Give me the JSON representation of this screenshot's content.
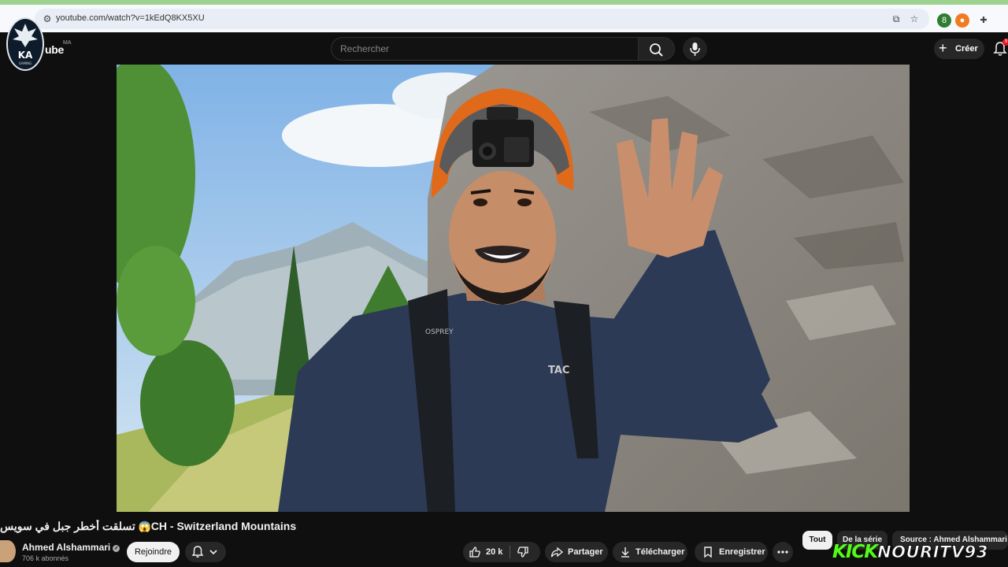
{
  "browser": {
    "url": "youtube.com/watch?v=1kEdQ8KX5XU",
    "extension_badge": "8"
  },
  "header": {
    "brand": "ube",
    "region": "MA",
    "logo_letters": "KA",
    "logo_subtext": "GAMING",
    "search_placeholder": "Rechercher",
    "create_label": "Créer",
    "notification_count": "9"
  },
  "video": {
    "title_arabic": "تسلقت أخطر جبل في سويس",
    "title_emoji": "😱",
    "title_suffix": "CH - Switzerland Mountains",
    "overlay_text_helmet": "OSPREY",
    "overlay_text_shirt": "TAC"
  },
  "channel": {
    "name": "Ahmed Alshammari",
    "subscribers": "706 k abonnés",
    "join_label": "Rejoindre"
  },
  "actions": {
    "likes": "20 k",
    "share_label": "Partager",
    "download_label": "Télécharger",
    "save_label": "Enregistrer"
  },
  "chips": {
    "all": "Tout",
    "series": "De la série",
    "source": "Source : Ahmed Alshammari"
  },
  "streamer_overlay": {
    "kick": "KICK",
    "handle": "NOURITV93"
  },
  "colors": {
    "background": "#0f0f0f",
    "kick_green": "#53fc18",
    "chrome_accent": "#9ed38f"
  }
}
